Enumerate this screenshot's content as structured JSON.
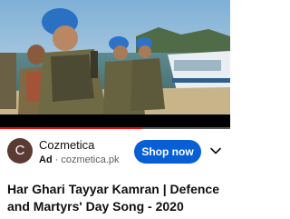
{
  "player": {
    "progress_fraction": 0.62,
    "progress_color": "#ff0000"
  },
  "ad": {
    "logo_letter": "C",
    "advertiser_name": "Cozmetica",
    "badge": "Ad",
    "separator": "·",
    "domain": "cozmetica.pk",
    "cta_label": "Shop now",
    "cta_color": "#065fd4",
    "more_icon": "chevron-down-icon"
  },
  "video": {
    "title": "Har Ghari Tayyar Kamran | Defence and Martyrs' Day Song - 2020"
  }
}
